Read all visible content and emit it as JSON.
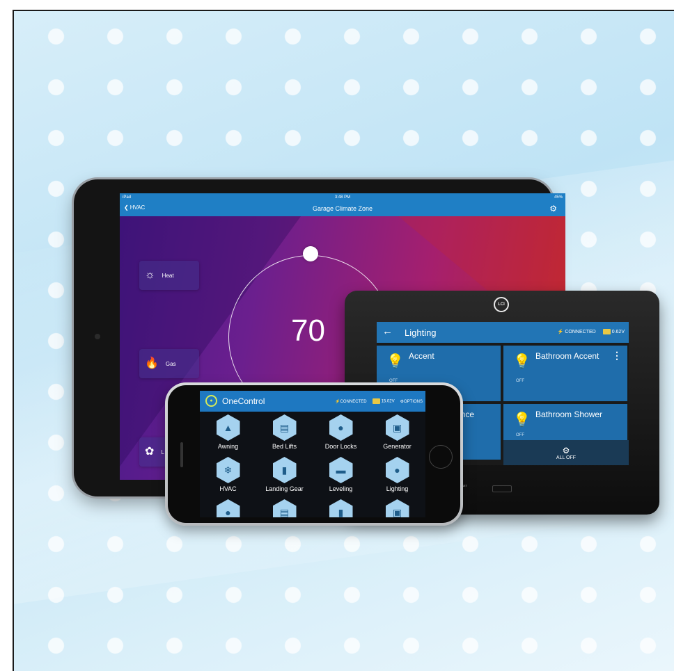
{
  "ipad": {
    "status_left": "iPad",
    "status_time": "3:48 PM",
    "status_right": "45%",
    "back_label": "HVAC",
    "title": "Garage Climate Zone",
    "modes": [
      {
        "label": "Heat",
        "icon": "sun-icon"
      },
      {
        "label": "Gas",
        "icon": "flame-icon"
      },
      {
        "label": "L",
        "icon": "fan-icon"
      }
    ],
    "temperature": "70"
  },
  "panel": {
    "logo": "LCI",
    "title": "Lighting",
    "connected": "CONNECTED",
    "voltage": "0.62V",
    "tiles": [
      {
        "name": "Accent",
        "state": "OFF"
      },
      {
        "name": "Bathroom Accent",
        "state": "OFF"
      },
      {
        "name": "conce",
        "state": ""
      },
      {
        "name": "Bathroom Shower",
        "state": "OFF"
      }
    ],
    "all_off": "ALL OFF",
    "bottom_labels": "SD    RESET"
  },
  "phone": {
    "app_title": "OneControl",
    "connected": "CONNECTED",
    "voltage": "15.02V",
    "options": "OPTIONS",
    "features": [
      {
        "label": "Awning",
        "icon": "awning-icon"
      },
      {
        "label": "Bed Lifts",
        "icon": "bed-icon"
      },
      {
        "label": "Door Locks",
        "icon": "lock-icon"
      },
      {
        "label": "Generator",
        "icon": "generator-icon"
      },
      {
        "label": "HVAC",
        "icon": "hvac-icon"
      },
      {
        "label": "Landing Gear",
        "icon": "landing-gear-icon"
      },
      {
        "label": "Leveling",
        "icon": "leveling-icon"
      },
      {
        "label": "Lighting",
        "icon": "bulb-icon"
      },
      {
        "label": "",
        "icon": "water-icon"
      },
      {
        "label": "",
        "icon": "slide-icon"
      },
      {
        "label": "",
        "icon": "tank-icon"
      },
      {
        "label": "",
        "icon": "tv-icon"
      }
    ]
  }
}
